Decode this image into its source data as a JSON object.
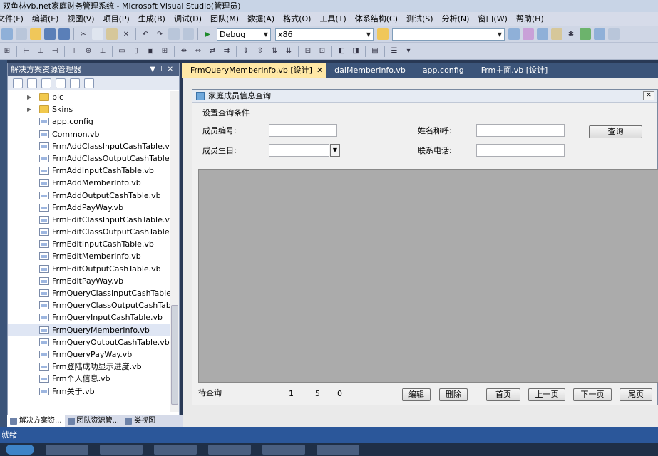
{
  "window": {
    "title": "双鱼林vb.net家庭财务管理系统 - Microsoft Visual Studio(管理员)"
  },
  "menu": [
    "文件(F)",
    "编辑(E)",
    "视图(V)",
    "项目(P)",
    "生成(B)",
    "调试(D)",
    "团队(M)",
    "数据(A)",
    "格式(O)",
    "工具(T)",
    "体系结构(C)",
    "测试(S)",
    "分析(N)",
    "窗口(W)",
    "帮助(H)"
  ],
  "toolbar": {
    "config": "Debug",
    "platform": "x86",
    "search": ""
  },
  "solution_explorer": {
    "title": "解决方案资源管理器",
    "items": [
      {
        "label": "pic",
        "type": "folder"
      },
      {
        "label": "Skins",
        "type": "folder"
      },
      {
        "label": "app.config",
        "type": "file"
      },
      {
        "label": "Common.vb",
        "type": "file"
      },
      {
        "label": "FrmAddClassInputCashTable.vb",
        "type": "file"
      },
      {
        "label": "FrmAddClassOutputCashTable.vb",
        "type": "file"
      },
      {
        "label": "FrmAddInputCashTable.vb",
        "type": "file"
      },
      {
        "label": "FrmAddMemberInfo.vb",
        "type": "file"
      },
      {
        "label": "FrmAddOutputCashTable.vb",
        "type": "file"
      },
      {
        "label": "FrmAddPayWay.vb",
        "type": "file"
      },
      {
        "label": "FrmEditClassInputCashTable.vb",
        "type": "file"
      },
      {
        "label": "FrmEditClassOutputCashTable.vb",
        "type": "file"
      },
      {
        "label": "FrmEditInputCashTable.vb",
        "type": "file"
      },
      {
        "label": "FrmEditMemberInfo.vb",
        "type": "file"
      },
      {
        "label": "FrmEditOutputCashTable.vb",
        "type": "file"
      },
      {
        "label": "FrmEditPayWay.vb",
        "type": "file"
      },
      {
        "label": "FrmQueryClassInputCashTable.vb",
        "type": "file"
      },
      {
        "label": "FrmQueryClassOutputCashTable.",
        "type": "file"
      },
      {
        "label": "FrmQueryInputCashTable.vb",
        "type": "file"
      },
      {
        "label": "FrmQueryMemberInfo.vb",
        "type": "file",
        "selected": true
      },
      {
        "label": "FrmQueryOutputCashTable.vb",
        "type": "file"
      },
      {
        "label": "FrmQueryPayWay.vb",
        "type": "file"
      },
      {
        "label": "Frm登陆成功显示进度.vb",
        "type": "file"
      },
      {
        "label": "Frm个人信息.vb",
        "type": "file"
      },
      {
        "label": "Frm关于.vb",
        "type": "file"
      }
    ],
    "bottom_tabs": [
      "解决方案资...",
      "团队资源管...",
      "类视图"
    ]
  },
  "doc_tabs": [
    {
      "label": "FrmQueryMemberInfo.vb [设计]",
      "active": true
    },
    {
      "label": "dalMemberInfo.vb",
      "active": false
    },
    {
      "label": "app.config",
      "active": false
    },
    {
      "label": "Frm主面.vb [设计]",
      "active": false
    }
  ],
  "form": {
    "title": "家庭成员信息查询",
    "group_label": "设置查询条件",
    "member_id_label": "成员编号:",
    "member_id_value": "",
    "name_label": "姓名称呼:",
    "name_value": "",
    "birthday_label": "成员生日:",
    "birthday_value": "",
    "phone_label": "联系电话:",
    "phone_value": "",
    "query_button": "查询",
    "status_label": "待查询",
    "page_num1": "1",
    "page_num2": "5",
    "page_num3": "0",
    "edit_button": "编辑",
    "delete_button": "删除",
    "first_button": "首页",
    "prev_button": "上一页",
    "next_button": "下一页",
    "last_button": "尾页"
  },
  "statusbar": {
    "text": "就绪"
  }
}
